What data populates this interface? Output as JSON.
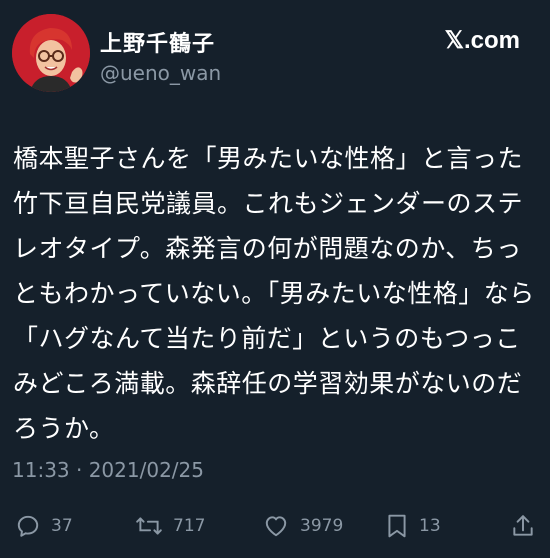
{
  "author": {
    "display_name": "上野千鶴子",
    "handle": "@ueno_wan",
    "avatar_icon": "bitmoji-avatar",
    "avatar_bg": "#c81f2c"
  },
  "brand": {
    "logo_text": "𝕏.com"
  },
  "tweet": {
    "text": "橋本聖子さんを「男みたいな性格」と言った竹下亘自民党議員。これもジェンダーのステレオタイプ。森発言の何が問題なのか、ちっともわかっていない。「男みたいな性格」なら「ハグなんて当たり前だ」というのもつっこみどころ満載。森辞任の学習効果がないのだろうか。",
    "timestamp": "11:33 · 2021/02/25"
  },
  "actions": {
    "reply": {
      "icon": "reply-icon",
      "count": "37"
    },
    "retweet": {
      "icon": "retweet-icon",
      "count": "717"
    },
    "like": {
      "icon": "heart-icon",
      "count": "3979"
    },
    "bookmark": {
      "icon": "bookmark-icon",
      "count": "13"
    },
    "share": {
      "icon": "share-icon"
    }
  },
  "colors": {
    "background": "#15202b",
    "text": "#ffffff",
    "secondary": "#8b98a5"
  }
}
